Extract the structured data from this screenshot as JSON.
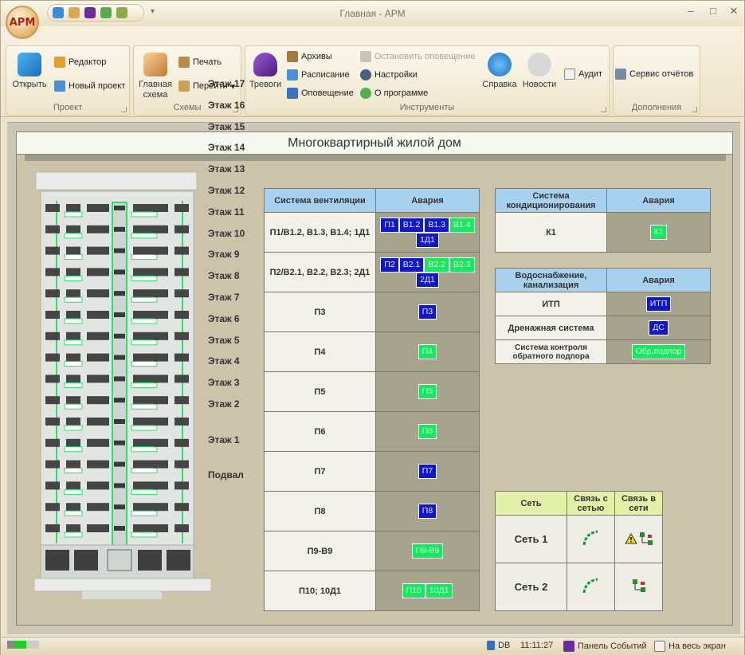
{
  "window": {
    "title": "Главная - АРМ",
    "logo": "АРМ"
  },
  "ribbon": {
    "groups": {
      "project": {
        "label": "Проект",
        "open": "Открыть",
        "editor": "Редактор",
        "new_project": "Новый проект"
      },
      "schemes": {
        "label": "Схемы",
        "main_scheme_l1": "Главная",
        "main_scheme_l2": "схема",
        "print": "Печать",
        "goto": "Перейти"
      },
      "tools": {
        "label": "Инструменты",
        "alarms": "Тревоги",
        "archives": "Архивы",
        "schedule": "Расписание",
        "notification": "Оповещение",
        "stop_notification": "Остановить оповещение",
        "settings": "Настройки",
        "about": "О программе",
        "help": "Справка",
        "news": "Новости",
        "audit": "Аудит"
      },
      "extras": {
        "label": "Дополнения",
        "report_service": "Сервис отчётов"
      }
    }
  },
  "panel": {
    "title": "Многоквартирный жилой дом"
  },
  "floors": [
    "Этаж 17",
    "Этаж 16",
    "Этаж 15",
    "Этаж 14",
    "Этаж 13",
    "Этаж 12",
    "Этаж 11",
    "Этаж 10",
    "Этаж 9",
    "Этаж 8",
    "Этаж 7",
    "Этаж 6",
    "Этаж 5",
    "Этаж 4",
    "Этаж 3",
    "Этаж 2",
    "Этаж 1",
    "Подвал"
  ],
  "ventilation": {
    "header_system": "Система вентиляции",
    "header_alarm": "Авария",
    "rows": [
      {
        "name": "П1/В1.2, В1.3, В1.4; 1Д1",
        "badges": [
          {
            "t": "П1",
            "c": "blue"
          },
          {
            "t": "В1.2",
            "c": "blue"
          },
          {
            "t": "В1.3",
            "c": "blue"
          },
          {
            "t": "В1.4",
            "c": "green"
          },
          {
            "t": "1Д1",
            "c": "blue"
          }
        ]
      },
      {
        "name": "П2/В2.1, В2.2, В2.3; 2Д1",
        "badges": [
          {
            "t": "П2",
            "c": "blue"
          },
          {
            "t": "В2.1",
            "c": "blue"
          },
          {
            "t": "В2.2",
            "c": "green"
          },
          {
            "t": "В2.3",
            "c": "green"
          },
          {
            "t": "2Д1",
            "c": "blue"
          }
        ]
      },
      {
        "name": "П3",
        "badges": [
          {
            "t": "П3",
            "c": "blue"
          }
        ]
      },
      {
        "name": "П4",
        "badges": [
          {
            "t": "П4",
            "c": "green"
          }
        ]
      },
      {
        "name": "П5",
        "badges": [
          {
            "t": "П5",
            "c": "green"
          }
        ]
      },
      {
        "name": "П6",
        "badges": [
          {
            "t": "П6",
            "c": "green"
          }
        ]
      },
      {
        "name": "П7",
        "badges": [
          {
            "t": "П7",
            "c": "blue"
          }
        ]
      },
      {
        "name": "П8",
        "badges": [
          {
            "t": "П8",
            "c": "blue"
          }
        ]
      },
      {
        "name": "П9-В9",
        "badges": [
          {
            "t": "П9-В9",
            "c": "green"
          }
        ]
      },
      {
        "name": "П10; 10Д1",
        "badges": [
          {
            "t": "П10",
            "c": "green"
          },
          {
            "t": "10Д1",
            "c": "green"
          }
        ]
      }
    ]
  },
  "ac": {
    "header_system": "Система кондиционирования",
    "header_alarm": "Авария",
    "row_name": "К1",
    "badge": "К1"
  },
  "water": {
    "header_system": "Водоснабжение, канализация",
    "header_alarm": "Авария",
    "rows": [
      {
        "name": "ИТП",
        "badge": "ИТП",
        "c": "blue"
      },
      {
        "name": "Дренажная система",
        "badge": "ДС",
        "c": "blue"
      },
      {
        "name": "Система контроля обратного подпора",
        "badge": "Обр.подпор",
        "c": "green"
      }
    ]
  },
  "network": {
    "header_net": "Сеть",
    "header_link1": "Связь с сетью",
    "header_link2": "Связь в сети",
    "rows": [
      {
        "name": "Сеть 1"
      },
      {
        "name": "Сеть 2"
      }
    ]
  },
  "statusbar": {
    "db": "DB",
    "time": "11:11:27",
    "events": "Панель Событий",
    "fullscreen": "На весь экран"
  },
  "colors": {
    "alarm_blue": "#1018c8",
    "alarm_green": "#18e860",
    "header_blue": "#a8d1f0",
    "network_header": "#e2f0a8"
  }
}
